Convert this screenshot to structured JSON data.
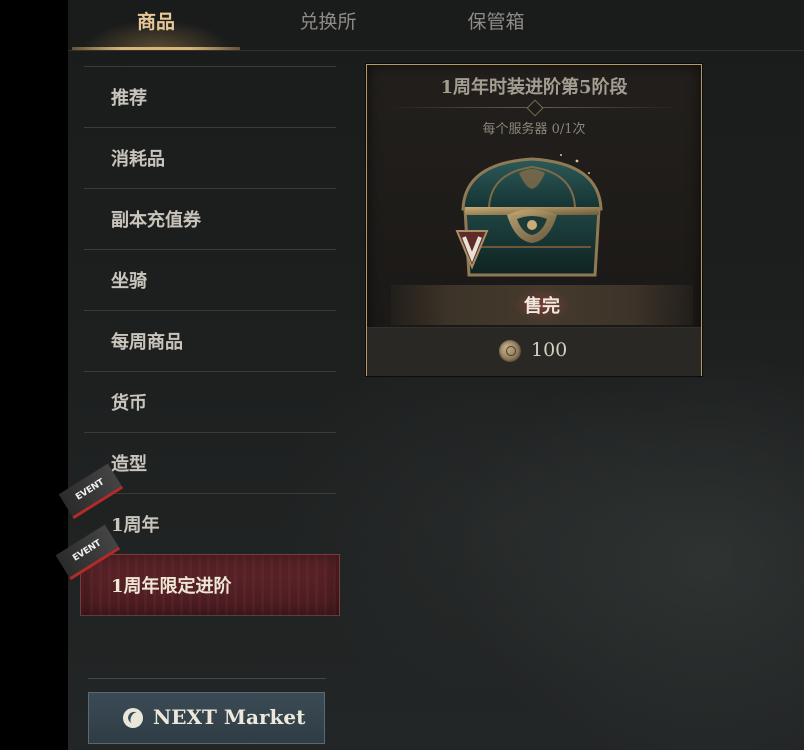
{
  "tabs": [
    {
      "label": "商品",
      "active": true
    },
    {
      "label": "兑换所",
      "active": false
    },
    {
      "label": "保管箱",
      "active": false
    }
  ],
  "sidebar": {
    "items": [
      {
        "label": "推荐"
      },
      {
        "label": "消耗品"
      },
      {
        "label": "副本充值券"
      },
      {
        "label": "坐骑"
      },
      {
        "label": "每周商品"
      },
      {
        "label": "货币"
      },
      {
        "label": "造型"
      },
      {
        "label": "1周年",
        "badge": "EVENT"
      },
      {
        "label": "1周年限定进阶",
        "badge": "EVENT",
        "active": true
      }
    ],
    "footer_button": {
      "label": "NEXT Market",
      "icon": "next-market-icon"
    }
  },
  "product": {
    "title": "1周年时装进阶第5阶段",
    "limit": "每个服务器 0/1次",
    "status": "售完",
    "price": "100",
    "currency_icon": "coin-icon",
    "image_icon": "treasure-chest-icon"
  },
  "colors": {
    "accent_gold": "#d8b37a",
    "active_item": "#4a1c21",
    "event_red": "#b22a2a",
    "market_button": "#34434c"
  }
}
